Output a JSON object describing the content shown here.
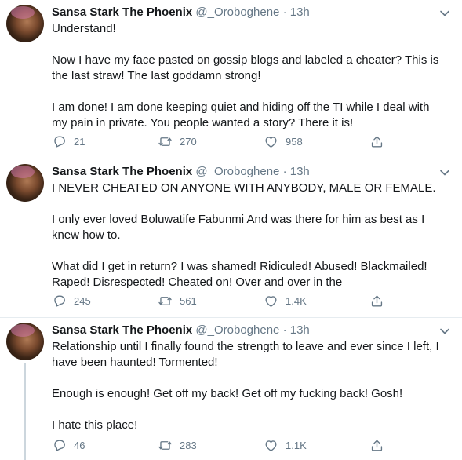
{
  "tweets": [
    {
      "name": "Sansa Stark The Phoenix",
      "handle": "@_Oroboghene",
      "dot": "·",
      "time": "13h",
      "text": "Understand!\n\nNow I have my face pasted on gossip blogs and labeled a cheater? This is the last straw! The last goddamn strong!\n\nI am done! I am done keeping quiet and hiding off the TI while I deal with my pain in private. You people wanted a story? There it is!",
      "replies": "21",
      "retweets": "270",
      "likes": "958"
    },
    {
      "name": "Sansa Stark The Phoenix",
      "handle": "@_Oroboghene",
      "dot": "·",
      "time": "13h",
      "text": "I NEVER CHEATED ON ANYONE WITH ANYBODY, MALE OR FEMALE.\n\nI only ever loved Boluwatife Fabunmi And was there for him as best as I knew how to.\n\nWhat did I get in return? I was shamed! Ridiculed! Abused! Blackmailed! Raped! Disrespected! Cheated on! Over and over in the",
      "replies": "245",
      "retweets": "561",
      "likes": "1.4K"
    },
    {
      "name": "Sansa Stark The Phoenix",
      "handle": "@_Oroboghene",
      "dot": "·",
      "time": "13h",
      "text": "Relationship until I finally found the strength to leave and ever since I left, I have been haunted! Tormented!\n\nEnough is enough! Get off my back! Get off my fucking back! Gosh!\n\nI hate this place!",
      "replies": "46",
      "retweets": "283",
      "likes": "1.1K"
    }
  ],
  "icons": {
    "reply": "reply-icon",
    "retweet": "retweet-icon",
    "like": "heart-icon",
    "share": "share-icon",
    "caret": "chevron-down-icon"
  },
  "colors": {
    "text": "#14171a",
    "secondary": "#657786",
    "thread_line": "#ccd6dd",
    "divider": "#e6ecf0"
  }
}
